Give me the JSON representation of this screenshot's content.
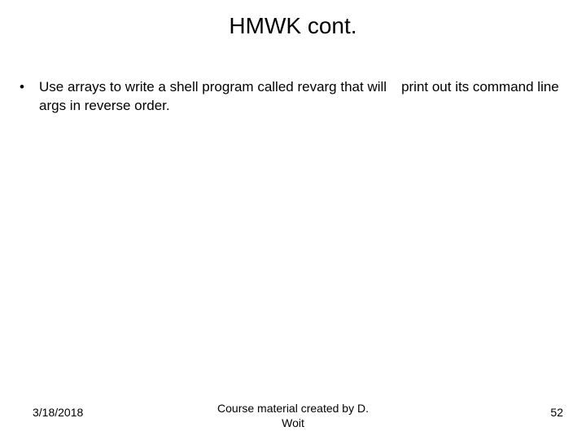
{
  "title": "HMWK cont.",
  "bullets": [
    {
      "text_before_gap": "Use arrays to write a shell program called revarg that will",
      "text_after_gap": "print out its command line args in reverse order."
    }
  ],
  "footer": {
    "date": "3/18/2018",
    "credit_line1": "Course material created by D.",
    "credit_line2": "Woit",
    "page": "52"
  }
}
